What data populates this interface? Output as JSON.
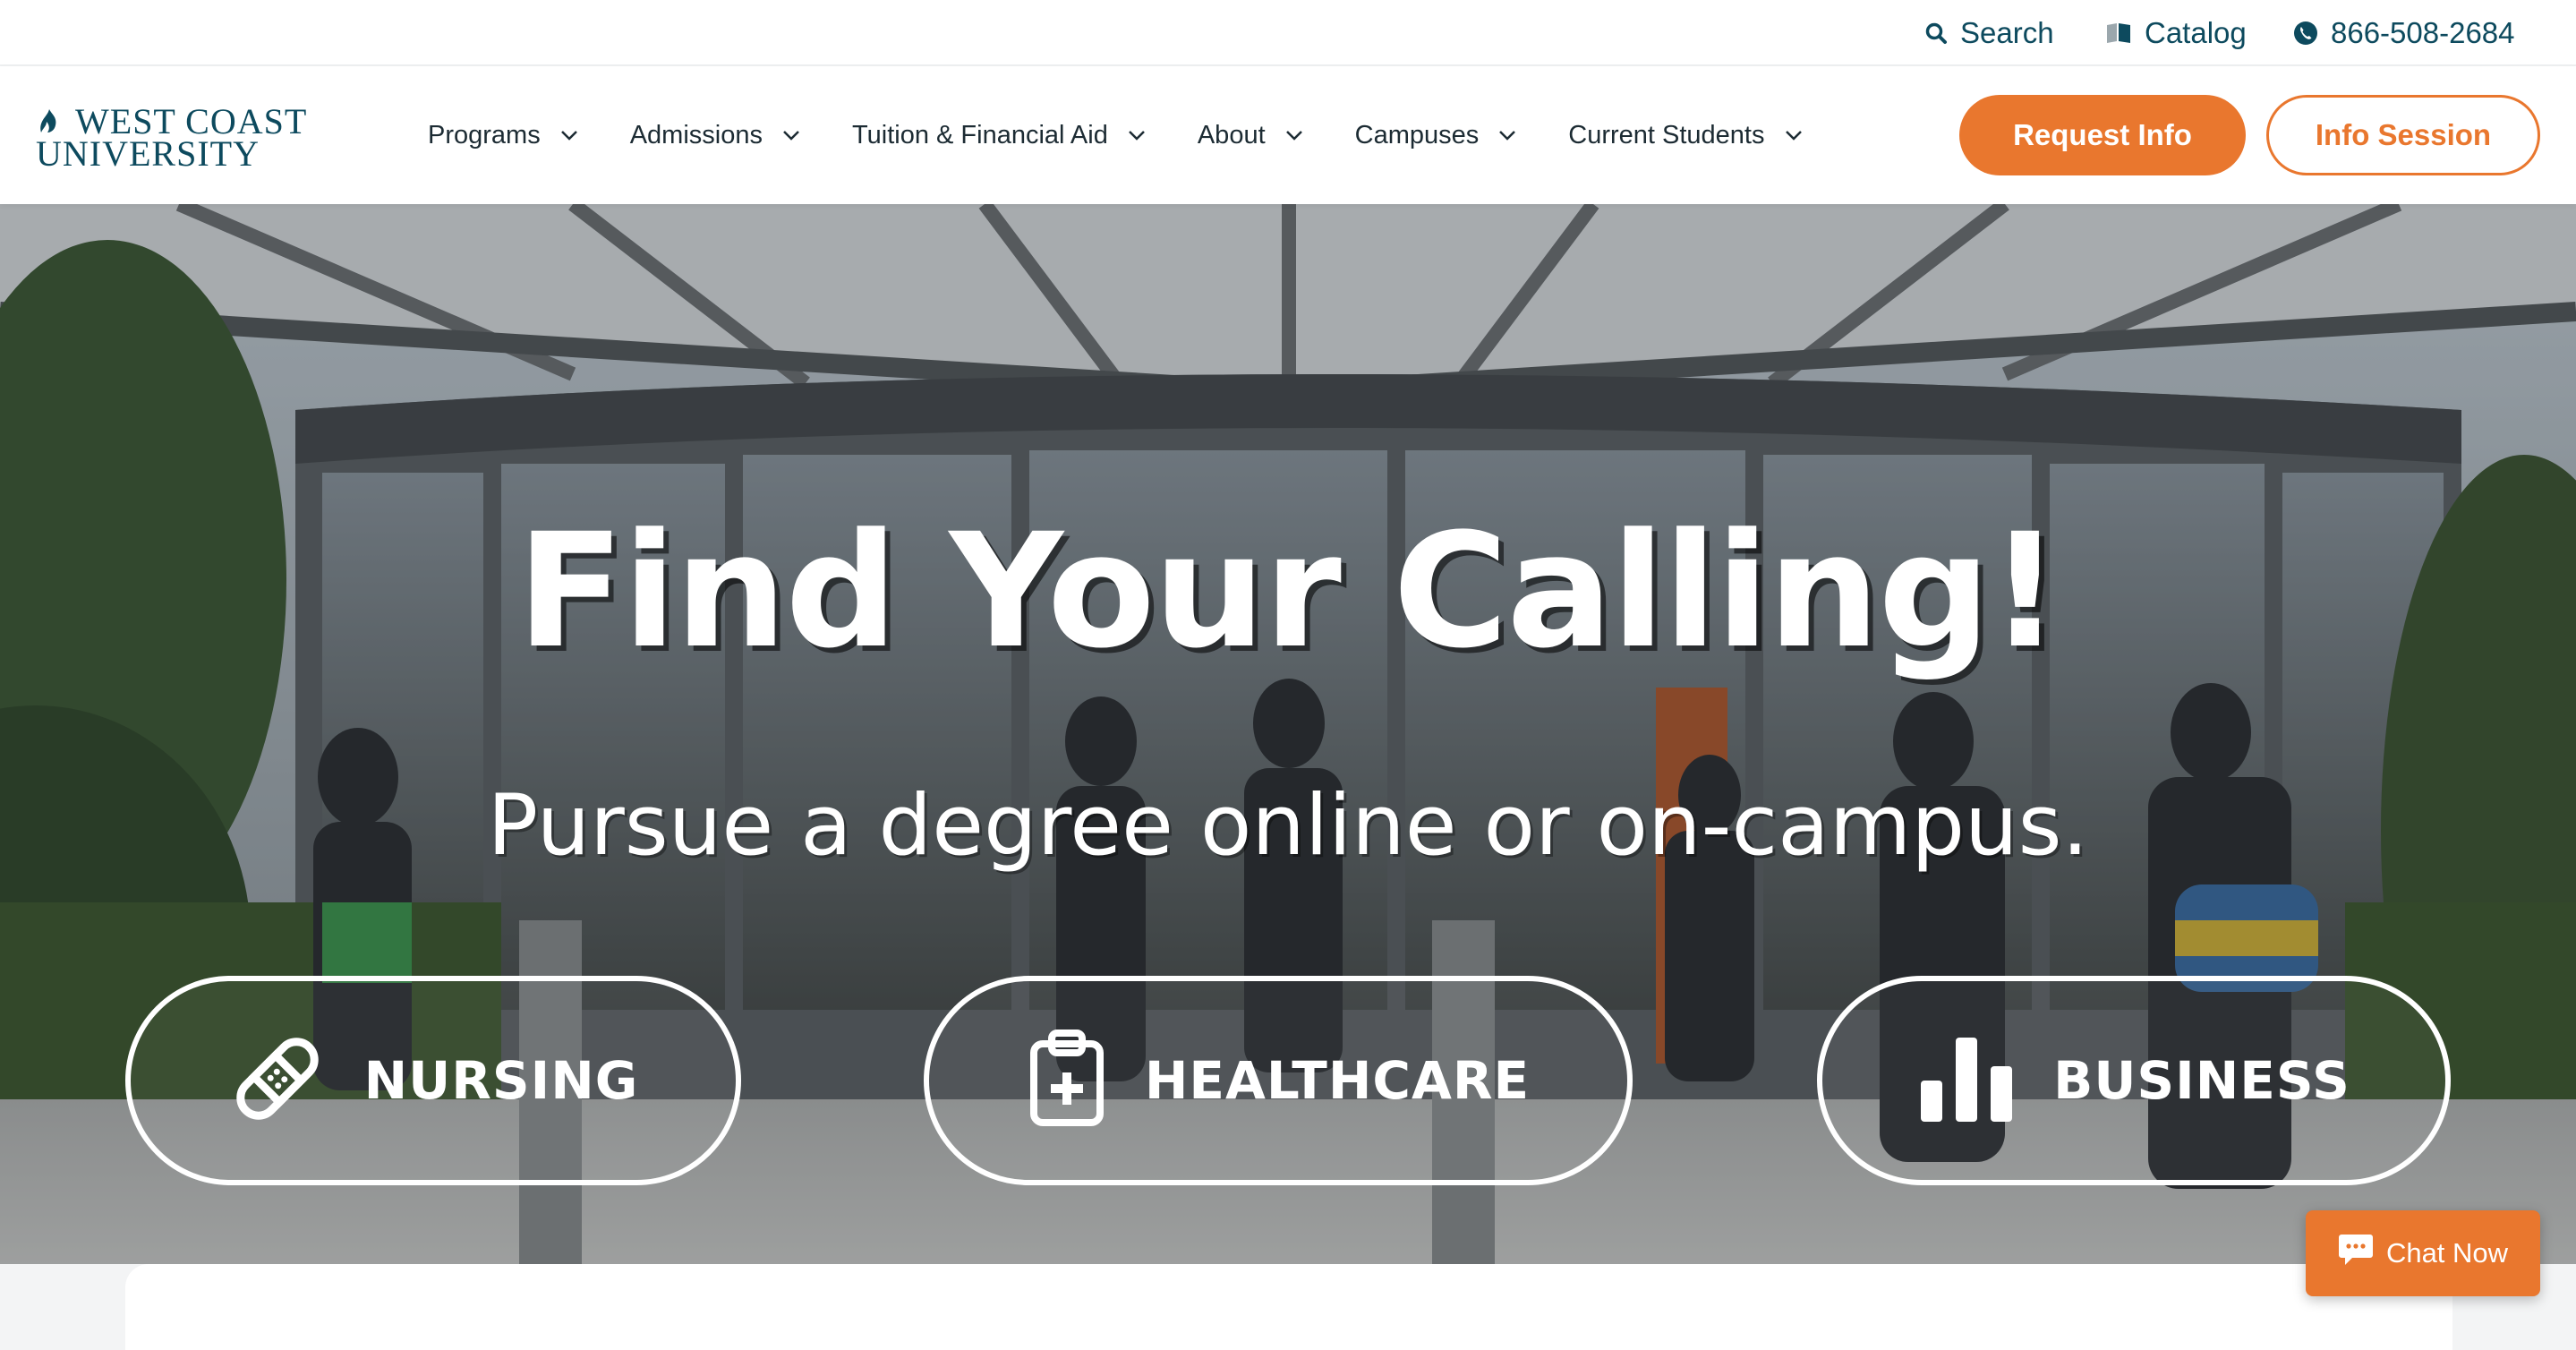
{
  "utility": {
    "search_label": "Search",
    "catalog_label": "Catalog",
    "phone": "866-508-2684",
    "icons": [
      "search-icon",
      "book-icon",
      "phone-icon"
    ]
  },
  "logo": {
    "line1": "WEST COAST",
    "line2": "UNIVERSITY",
    "icon": "flame-icon"
  },
  "nav": {
    "items": [
      {
        "label": "Programs"
      },
      {
        "label": "Admissions"
      },
      {
        "label": "Tuition & Financial Aid"
      },
      {
        "label": "About"
      },
      {
        "label": "Campuses"
      },
      {
        "label": "Current Students"
      }
    ],
    "dropdown_icon": "chevron-down-icon"
  },
  "cta": {
    "request_info": "Request Info",
    "info_session": "Info Session"
  },
  "hero": {
    "title": "Find Your Calling!",
    "subtitle": "Pursue a degree online or on-campus.",
    "programs": [
      {
        "label": "NURSING",
        "icon": "bandage-icon"
      },
      {
        "label": "HEALTHCARE",
        "icon": "clipboard-plus-icon"
      },
      {
        "label": "BUSINESS",
        "icon": "bar-chart-icon"
      }
    ]
  },
  "chat": {
    "label": "Chat Now",
    "icon": "chat-bubble-icon"
  },
  "colors": {
    "brand_teal": "#0d4a5e",
    "accent_orange": "#e9772e",
    "text_dark": "#1c2b33"
  }
}
